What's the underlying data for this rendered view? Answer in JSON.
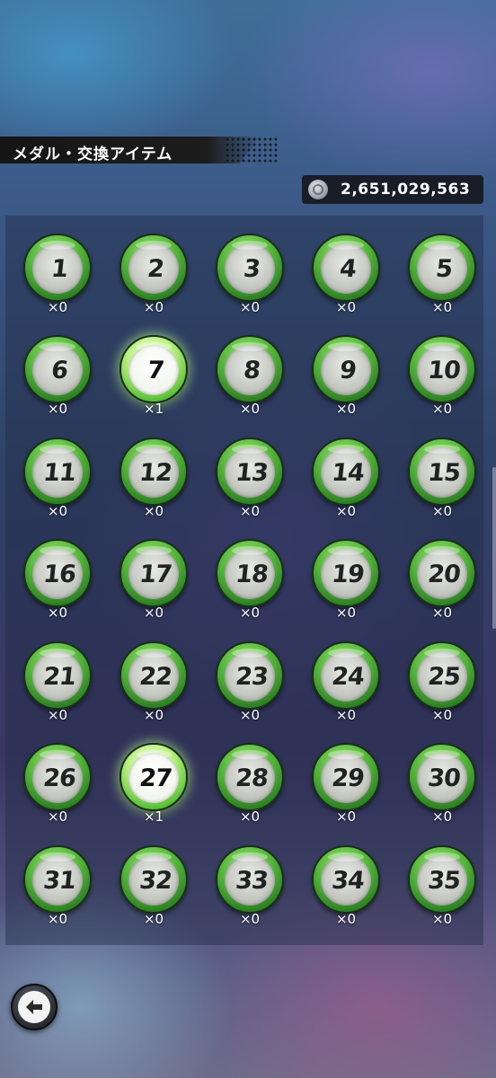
{
  "header": {
    "title": "メダル・交換アイテム"
  },
  "currency": {
    "icon": "coin-icon",
    "amount": "2,651,029,563"
  },
  "medals": [
    {
      "number": "1",
      "count": "×0",
      "owned": false
    },
    {
      "number": "2",
      "count": "×0",
      "owned": false
    },
    {
      "number": "3",
      "count": "×0",
      "owned": false
    },
    {
      "number": "4",
      "count": "×0",
      "owned": false
    },
    {
      "number": "5",
      "count": "×0",
      "owned": false
    },
    {
      "number": "6",
      "count": "×0",
      "owned": false
    },
    {
      "number": "7",
      "count": "×1",
      "owned": true
    },
    {
      "number": "8",
      "count": "×0",
      "owned": false
    },
    {
      "number": "9",
      "count": "×0",
      "owned": false
    },
    {
      "number": "10",
      "count": "×0",
      "owned": false
    },
    {
      "number": "11",
      "count": "×0",
      "owned": false
    },
    {
      "number": "12",
      "count": "×0",
      "owned": false
    },
    {
      "number": "13",
      "count": "×0",
      "owned": false
    },
    {
      "number": "14",
      "count": "×0",
      "owned": false
    },
    {
      "number": "15",
      "count": "×0",
      "owned": false
    },
    {
      "number": "16",
      "count": "×0",
      "owned": false
    },
    {
      "number": "17",
      "count": "×0",
      "owned": false
    },
    {
      "number": "18",
      "count": "×0",
      "owned": false
    },
    {
      "number": "19",
      "count": "×0",
      "owned": false
    },
    {
      "number": "20",
      "count": "×0",
      "owned": false
    },
    {
      "number": "21",
      "count": "×0",
      "owned": false
    },
    {
      "number": "22",
      "count": "×0",
      "owned": false
    },
    {
      "number": "23",
      "count": "×0",
      "owned": false
    },
    {
      "number": "24",
      "count": "×0",
      "owned": false
    },
    {
      "number": "25",
      "count": "×0",
      "owned": false
    },
    {
      "number": "26",
      "count": "×0",
      "owned": false
    },
    {
      "number": "27",
      "count": "×1",
      "owned": true
    },
    {
      "number": "28",
      "count": "×0",
      "owned": false
    },
    {
      "number": "29",
      "count": "×0",
      "owned": false
    },
    {
      "number": "30",
      "count": "×0",
      "owned": false
    },
    {
      "number": "31",
      "count": "×0",
      "owned": false
    },
    {
      "number": "32",
      "count": "×0",
      "owned": false
    },
    {
      "number": "33",
      "count": "×0",
      "owned": false
    },
    {
      "number": "34",
      "count": "×0",
      "owned": false
    },
    {
      "number": "35",
      "count": "×0",
      "owned": false
    }
  ],
  "back_button": {
    "icon": "arrow-left-icon"
  },
  "colors": {
    "medal_green": "#53b43a",
    "medal_owned_glow": "#b8f07d",
    "title_bar": "#1d1d1d"
  }
}
